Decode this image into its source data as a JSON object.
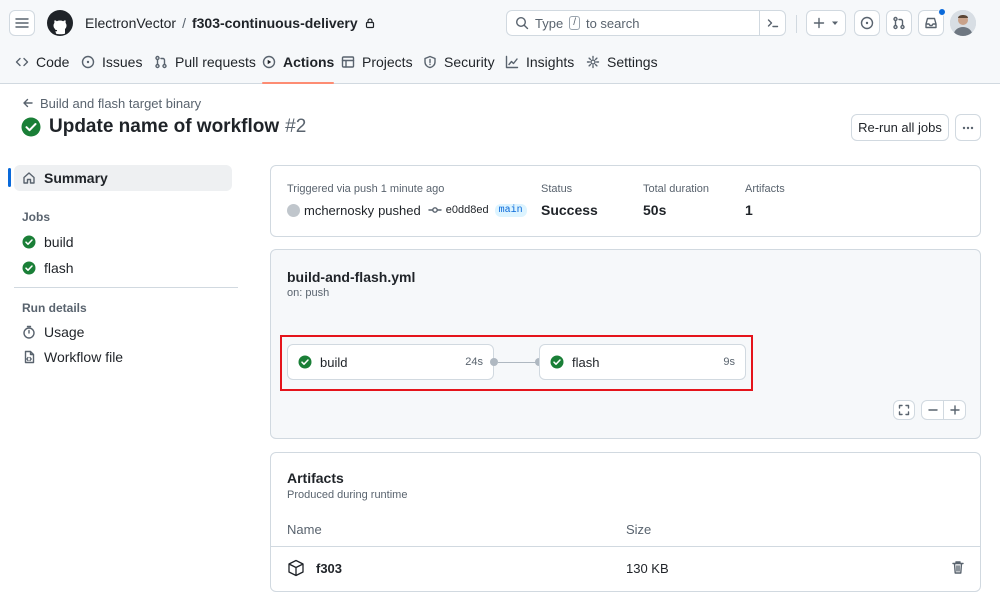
{
  "header": {
    "owner": "ElectronVector",
    "separator": "/",
    "repo": "f303-continuous-delivery",
    "search_prefix": "Type",
    "search_key": "/",
    "search_suffix": "to search"
  },
  "nav": {
    "tabs": [
      {
        "label": "Code"
      },
      {
        "label": "Issues"
      },
      {
        "label": "Pull requests"
      },
      {
        "label": "Actions"
      },
      {
        "label": "Projects"
      },
      {
        "label": "Security"
      },
      {
        "label": "Insights"
      },
      {
        "label": "Settings"
      }
    ],
    "active": "Actions"
  },
  "run": {
    "breadcrumb": "Build and flash target binary",
    "title": "Update name of workflow",
    "number": "#2",
    "rerun_label": "Re-run all jobs"
  },
  "sidebar": {
    "summary": "Summary",
    "jobs_heading": "Jobs",
    "jobs": [
      {
        "label": "build"
      },
      {
        "label": "flash"
      }
    ],
    "run_details_heading": "Run details",
    "usage": "Usage",
    "workflow_file": "Workflow file"
  },
  "summary": {
    "trigger": "Triggered via push 1 minute ago",
    "user": "mchernosky",
    "pushed": "pushed",
    "commit": "e0dd8ed",
    "branch": "main",
    "status_label": "Status",
    "status_value": "Success",
    "duration_label": "Total duration",
    "duration_value": "50s",
    "artifacts_label": "Artifacts",
    "artifacts_value": "1"
  },
  "workflow": {
    "file": "build-and-flash.yml",
    "on": "on: push",
    "jobs": [
      {
        "name": "build",
        "duration": "24s"
      },
      {
        "name": "flash",
        "duration": "9s"
      }
    ]
  },
  "artifacts": {
    "title": "Artifacts",
    "subtitle": "Produced during runtime",
    "col_name": "Name",
    "col_size": "Size",
    "rows": [
      {
        "name": "f303",
        "size": "130 KB"
      }
    ]
  },
  "colors": {
    "success": "#1a7f37",
    "accent_underline": "#fd8c73",
    "highlight_box": "#e5141b",
    "sidebar_active_bar": "#0969da"
  }
}
